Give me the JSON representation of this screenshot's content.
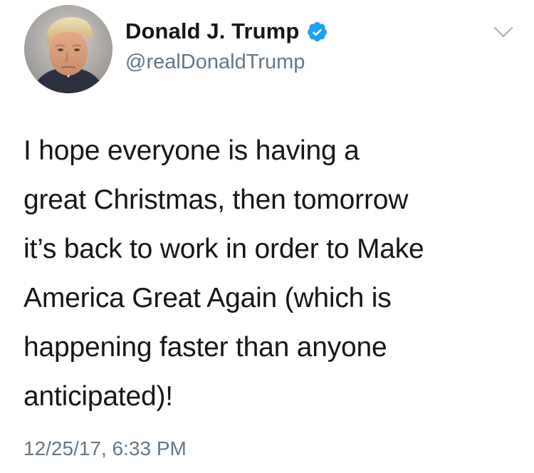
{
  "author": {
    "display_name": "Donald J. Trump",
    "handle": "@realDonaldTrump",
    "verified": true,
    "avatar_icon": "profile-photo"
  },
  "tweet": {
    "lines": [
      "I hope everyone is having a",
      "great Christmas, then tomorrow",
      "it’s back to work in order to Make",
      "America Great Again (which is",
      "happening faster than anyone",
      "anticipated)!"
    ],
    "timestamp": "12/25/17, 6:33 PM"
  },
  "icons": {
    "verified": "verified-badge-icon",
    "menu": "chevron-down-icon"
  },
  "colors": {
    "text": "#14171a",
    "secondary_text": "#657786",
    "verified_blue": "#1da1f2",
    "chevron": "#aab8c2",
    "background": "#ffffff"
  }
}
